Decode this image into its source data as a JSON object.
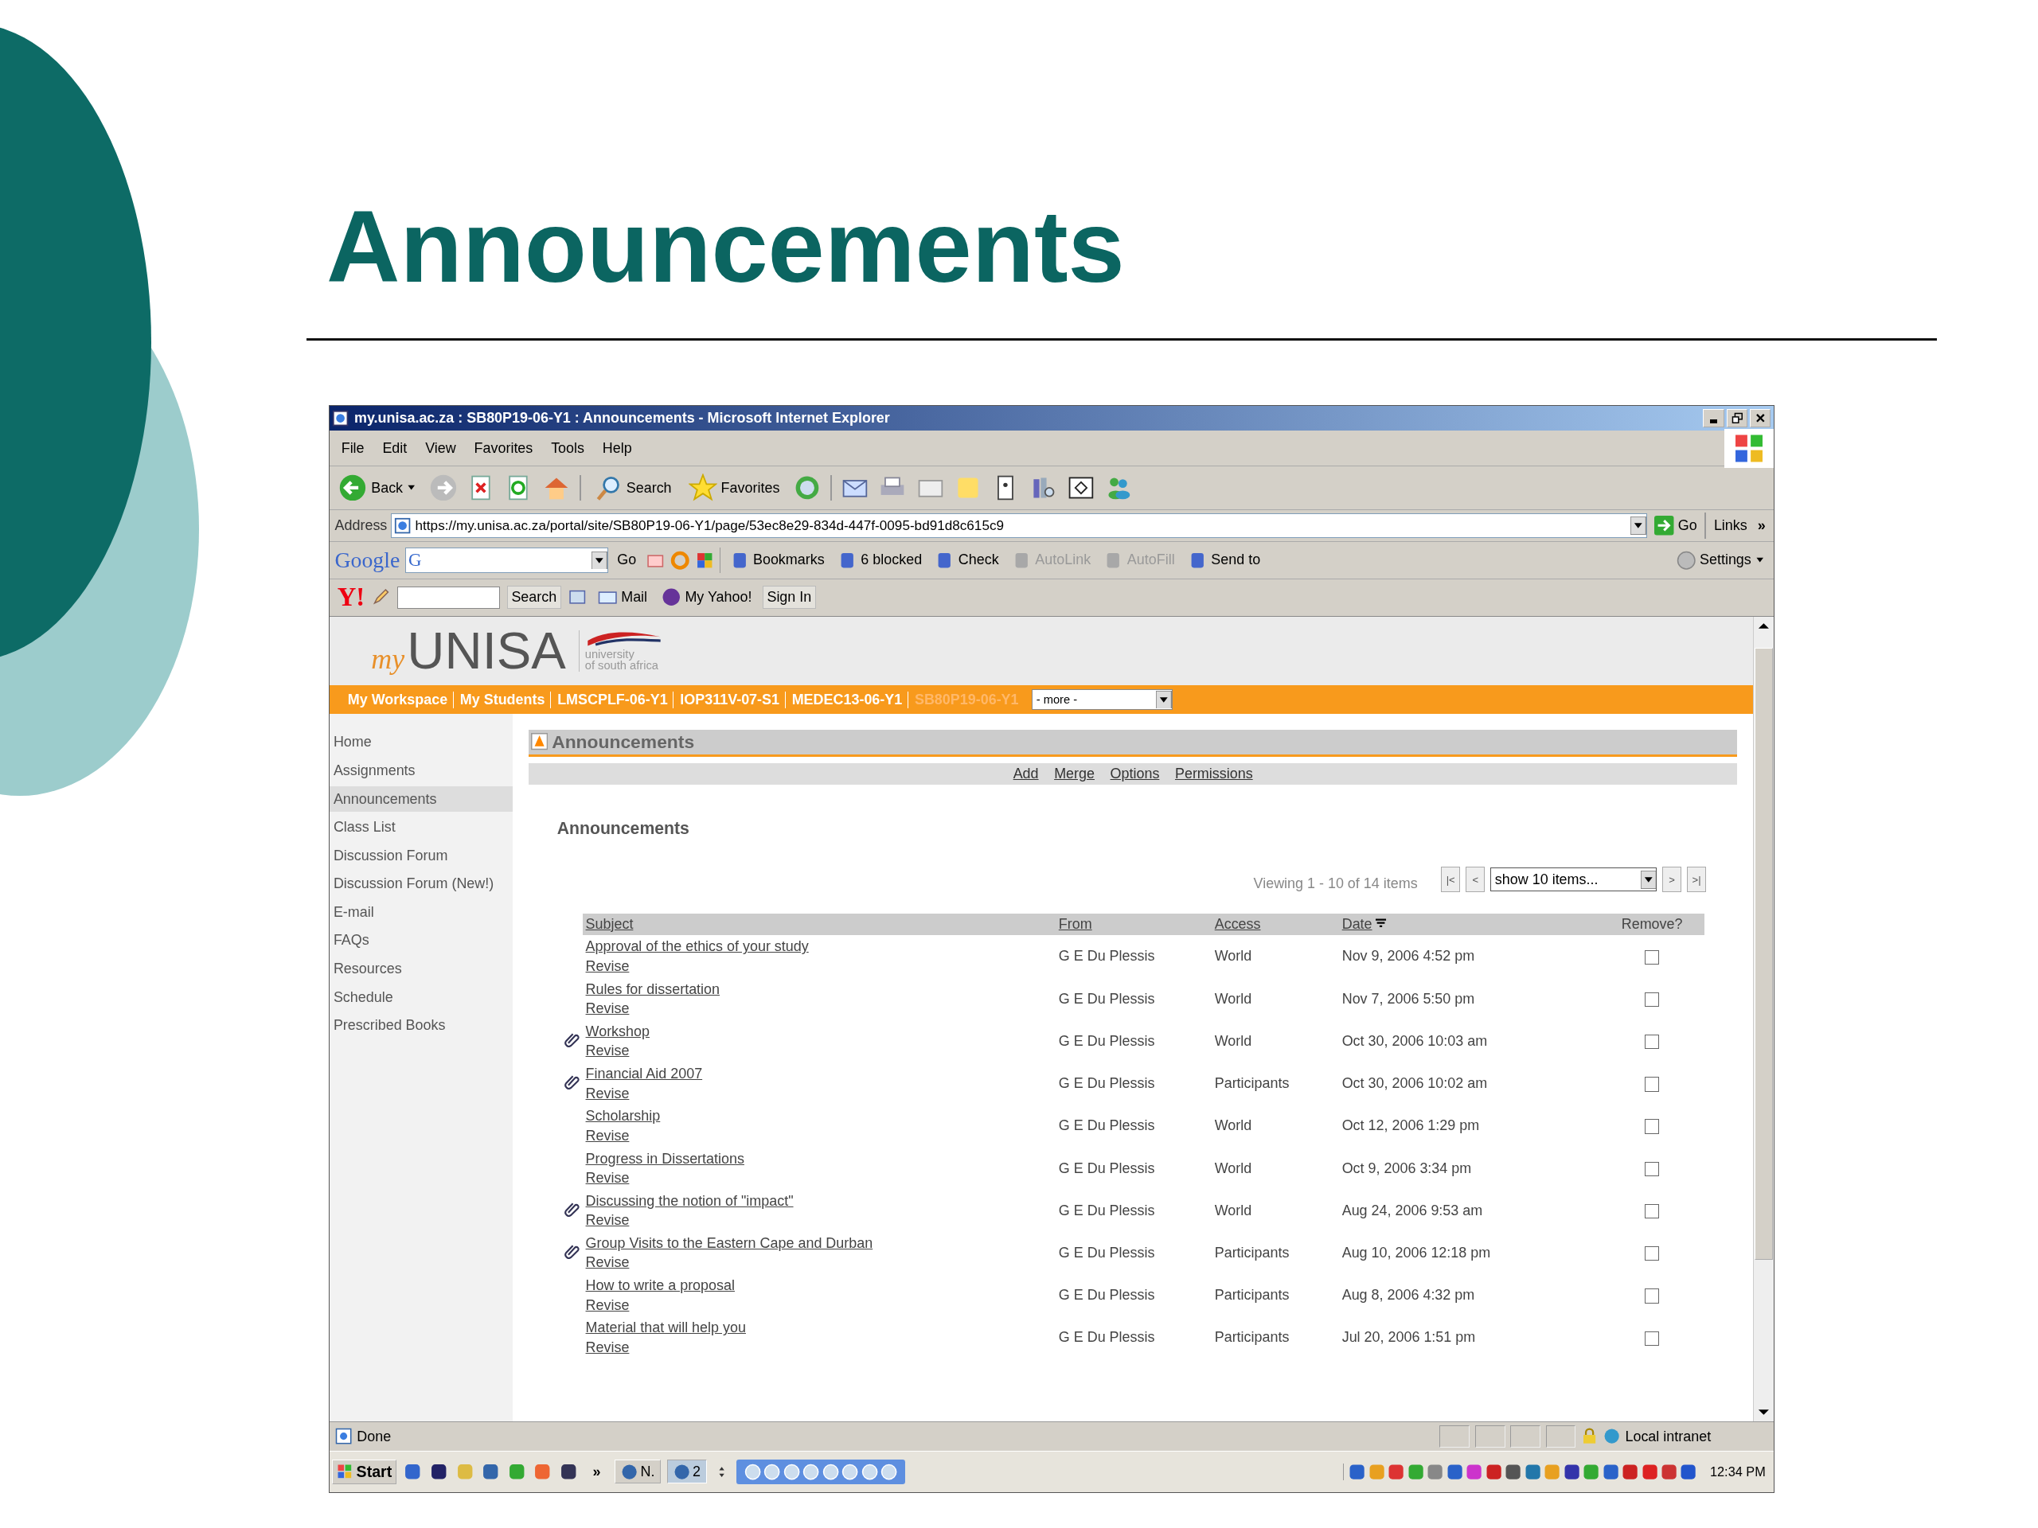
{
  "slide": {
    "title": "Announcements"
  },
  "window": {
    "title": "my.unisa.ac.za : SB80P19-06-Y1 : Announcements - Microsoft Internet Explorer"
  },
  "menu": [
    "File",
    "Edit",
    "View",
    "Favorites",
    "Tools",
    "Help"
  ],
  "toolbar": {
    "back": "Back",
    "search": "Search",
    "favorites": "Favorites"
  },
  "address": {
    "label": "Address",
    "url": "https://my.unisa.ac.za/portal/site/SB80P19-06-Y1/page/53ec8e29-834d-447f-0095-bd91d8c615c9",
    "go": "Go",
    "links": "Links",
    "chevron": "»"
  },
  "google_bar": {
    "logo": "Google",
    "field_logo": "G",
    "go": "Go",
    "items": [
      {
        "label": "Bookmarks",
        "disabled": false
      },
      {
        "label": "6 blocked",
        "disabled": false
      },
      {
        "label": "Check",
        "disabled": false
      },
      {
        "label": "AutoLink",
        "disabled": true
      },
      {
        "label": "AutoFill",
        "disabled": true
      },
      {
        "label": "Send to",
        "disabled": false
      }
    ],
    "settings": "Settings"
  },
  "yahoo_bar": {
    "logo": "Y!",
    "search": "Search",
    "mail": "Mail",
    "my_yahoo": "My Yahoo!",
    "sign_in": "Sign In"
  },
  "site": {
    "logo_my": "my",
    "logo_name": "UNISA",
    "logo_sub1": "university",
    "logo_sub2": "of south africa",
    "tabs": [
      {
        "label": "My Workspace",
        "selected": false
      },
      {
        "label": "My Students",
        "selected": false
      },
      {
        "label": "LMSCPLF-06-Y1",
        "selected": false
      },
      {
        "label": "IOP311V-07-S1",
        "selected": false
      },
      {
        "label": "MEDEC13-06-Y1",
        "selected": false
      },
      {
        "label": "SB80P19-06-Y1",
        "selected": true
      }
    ],
    "more": "- more -"
  },
  "sidebar": [
    {
      "label": "Home",
      "selected": false
    },
    {
      "label": "Assignments",
      "selected": false
    },
    {
      "label": "Announcements",
      "selected": true
    },
    {
      "label": "Class List",
      "selected": false
    },
    {
      "label": "Discussion Forum",
      "selected": false
    },
    {
      "label": "Discussion Forum (New!)",
      "selected": false
    },
    {
      "label": "E-mail",
      "selected": false
    },
    {
      "label": "FAQs",
      "selected": false
    },
    {
      "label": "Resources",
      "selected": false
    },
    {
      "label": "Schedule",
      "selected": false
    },
    {
      "label": "Prescribed Books",
      "selected": false
    }
  ],
  "tool": {
    "title": "Announcements",
    "actions": [
      "Add",
      "Merge",
      "Options",
      "Permissions"
    ],
    "heading": "Announcements",
    "viewing": "Viewing 1 - 10 of 14 items",
    "page_size": "show 10 items...",
    "first": "|<",
    "prev": "<",
    "next": ">",
    "last": ">|"
  },
  "table": {
    "columns": [
      {
        "label": "Subject",
        "sorted": false
      },
      {
        "label": "From",
        "sorted": false
      },
      {
        "label": "Access",
        "sorted": false
      },
      {
        "label": "Date",
        "sorted": true
      },
      {
        "label": "Remove?",
        "sorted": false
      }
    ],
    "rows": [
      {
        "subject": "Approval of the ethics of your study",
        "revise": "Revise",
        "from": "G E Du Plessis",
        "access": "World",
        "date": "Nov 9, 2006 4:52 pm",
        "attachment": false,
        "remove": false
      },
      {
        "subject": "Rules for dissertation",
        "revise": "Revise",
        "from": "G E Du Plessis",
        "access": "World",
        "date": "Nov 7, 2006 5:50 pm",
        "attachment": false,
        "remove": false
      },
      {
        "subject": "Workshop",
        "revise": "Revise",
        "from": "G E Du Plessis",
        "access": "World",
        "date": "Oct 30, 2006 10:03 am",
        "attachment": true,
        "remove": false
      },
      {
        "subject": "Financial Aid 2007",
        "revise": "Revise",
        "from": "G E Du Plessis",
        "access": "Participants",
        "date": "Oct 30, 2006 10:02 am",
        "attachment": true,
        "remove": false
      },
      {
        "subject": "Scholarship",
        "revise": "Revise",
        "from": "G E Du Plessis",
        "access": "World",
        "date": "Oct 12, 2006 1:29 pm",
        "attachment": false,
        "remove": false
      },
      {
        "subject": "Progress in Dissertations",
        "revise": "Revise",
        "from": "G E Du Plessis",
        "access": "World",
        "date": "Oct 9, 2006 3:34 pm",
        "attachment": false,
        "remove": false
      },
      {
        "subject": "Discussing the notion of \"impact\"",
        "revise": "Revise",
        "from": "G E Du Plessis",
        "access": "World",
        "date": "Aug 24, 2006 9:53 am",
        "attachment": true,
        "remove": false
      },
      {
        "subject": "Group Visits to the Eastern Cape and Durban",
        "revise": "Revise",
        "from": "G E Du Plessis",
        "access": "Participants",
        "date": "Aug 10, 2006 12:18 pm",
        "attachment": true,
        "remove": false
      },
      {
        "subject": "How to write a proposal",
        "revise": "Revise",
        "from": "G E Du Plessis",
        "access": "Participants",
        "date": "Aug 8, 2006 4:32 pm",
        "attachment": false,
        "remove": false
      },
      {
        "subject": "Material that will help you",
        "revise": "Revise",
        "from": "G E Du Plessis",
        "access": "Participants",
        "date": "Jul 20, 2006 1:51 pm",
        "attachment": false,
        "remove": false
      }
    ]
  },
  "status_bar": {
    "text": "Done",
    "zone": "Local intranet"
  },
  "taskbar": {
    "start": "Start",
    "more": "»",
    "tasks": [
      {
        "label": "N.",
        "selected": false
      },
      {
        "label": "2",
        "selected": true
      }
    ],
    "time": "12:34 PM"
  }
}
